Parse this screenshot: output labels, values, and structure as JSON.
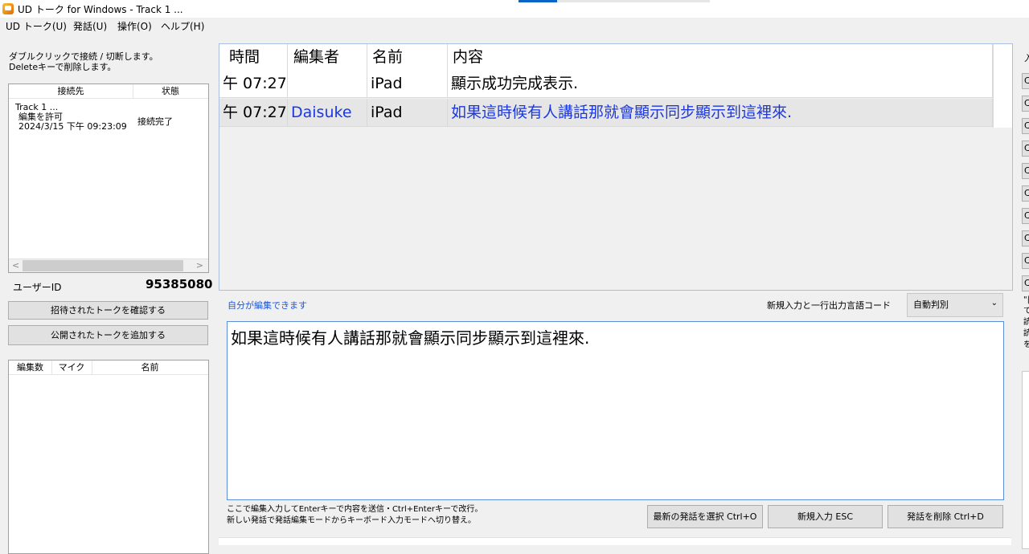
{
  "window": {
    "title": "UD トーク for Windows - Track 1 ..."
  },
  "menu": [
    {
      "label": "UD トーク(U)"
    },
    {
      "label": "発話(U)"
    },
    {
      "label": "操作(O)"
    },
    {
      "label": "ヘルプ(H)"
    }
  ],
  "left": {
    "hint_line1": "ダブルクリックで接続 / 切断します。",
    "hint_line2": "Deleteキーで削除します。",
    "connections": {
      "headers": [
        "接続先",
        "状態"
      ],
      "rows": [
        {
          "line1": "Track 1 ...",
          "line2": "編集を許可",
          "line3": "2024/3/15 下午 09:23:09",
          "state": "接続完了"
        }
      ]
    },
    "user_id_label": "ユーザーID",
    "user_id_value": "95385080",
    "btn_invited": "招待されたトークを確認する",
    "btn_public": "公開されたトークを追加する",
    "members": {
      "headers": [
        "編集数",
        "マイク",
        "名前"
      ]
    }
  },
  "table": {
    "headers": [
      "時間",
      "編集者",
      "名前",
      "内容"
    ],
    "rows": [
      {
        "time": "午 07:27",
        "editor": "",
        "name": "iPad",
        "content": "顯示成功完成表示."
      },
      {
        "time": "午 07:27",
        "editor": "Daisuke",
        "name": "iPad",
        "content": "如果這時候有人講話那就會顯示同步顯示到這裡來."
      }
    ]
  },
  "editor": {
    "can_edit_label": "自分が編集できます",
    "lang_label": "新規入力と一行出力言語コード",
    "lang_value": "自動判別",
    "text": "如果這時候有人講話那就會顯示同步顯示到這裡來.",
    "help_line1": "ここで編集入力してEnterキーで内容を送信・Ctrl+Enterキーで改行。",
    "help_line2": "新しい発話で発話編集モードからキーボード入力モードへ切り替え。",
    "btn_latest": "最新の発話を選択 Ctrl+O",
    "btn_new": "新規入力 ESC",
    "btn_delete": "発話を削除 Ctrl+D"
  },
  "right": {
    "top_label": "入",
    "buttons": [
      "C",
      "C",
      "C",
      "C",
      "C",
      "C",
      "C",
      "C",
      "C",
      "C"
    ],
    "text_lines": [
      "\"|",
      "て",
      "",
      "読",
      "",
      "読",
      "を"
    ]
  },
  "colors": {
    "accent_blue": "#1b37e2",
    "selected_row": "#e6e6e6",
    "editor_border": "#5b8ed6"
  }
}
